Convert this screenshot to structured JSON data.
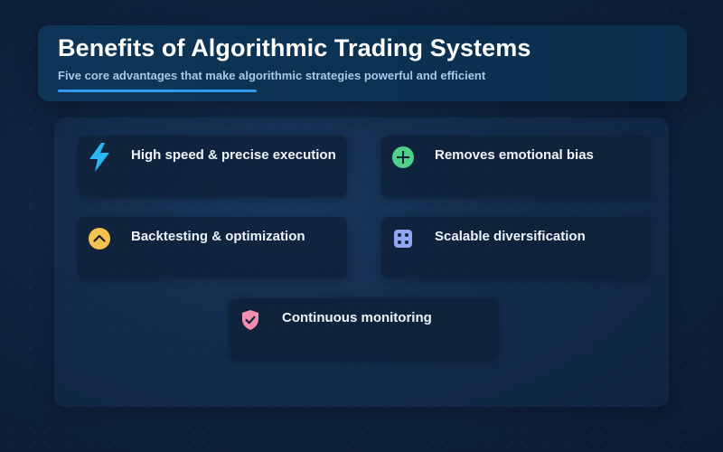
{
  "header": {
    "title": "Benefits of Algorithmic Trading Systems",
    "subtitle": "Five core advantages that make algorithmic strategies powerful and efficient"
  },
  "benefits": [
    {
      "label": "High speed & precise execution",
      "icon": "lightning-icon",
      "color": "#29b6f6"
    },
    {
      "label": "Removes emotional bias",
      "icon": "plus-circle-icon",
      "color": "#4fd08a"
    },
    {
      "label": "Backtesting & optimization",
      "icon": "chevron-up-circle-icon",
      "color": "#f2c14e"
    },
    {
      "label": "Scalable diversification",
      "icon": "dice-icon",
      "color": "#8fa8f0"
    },
    {
      "label": "Continuous monitoring",
      "icon": "shield-check-icon",
      "color": "#f48fb1"
    }
  ],
  "colors": {
    "accent": "#2f9bf0",
    "background": "#0f2440",
    "card": "#0e2038"
  }
}
